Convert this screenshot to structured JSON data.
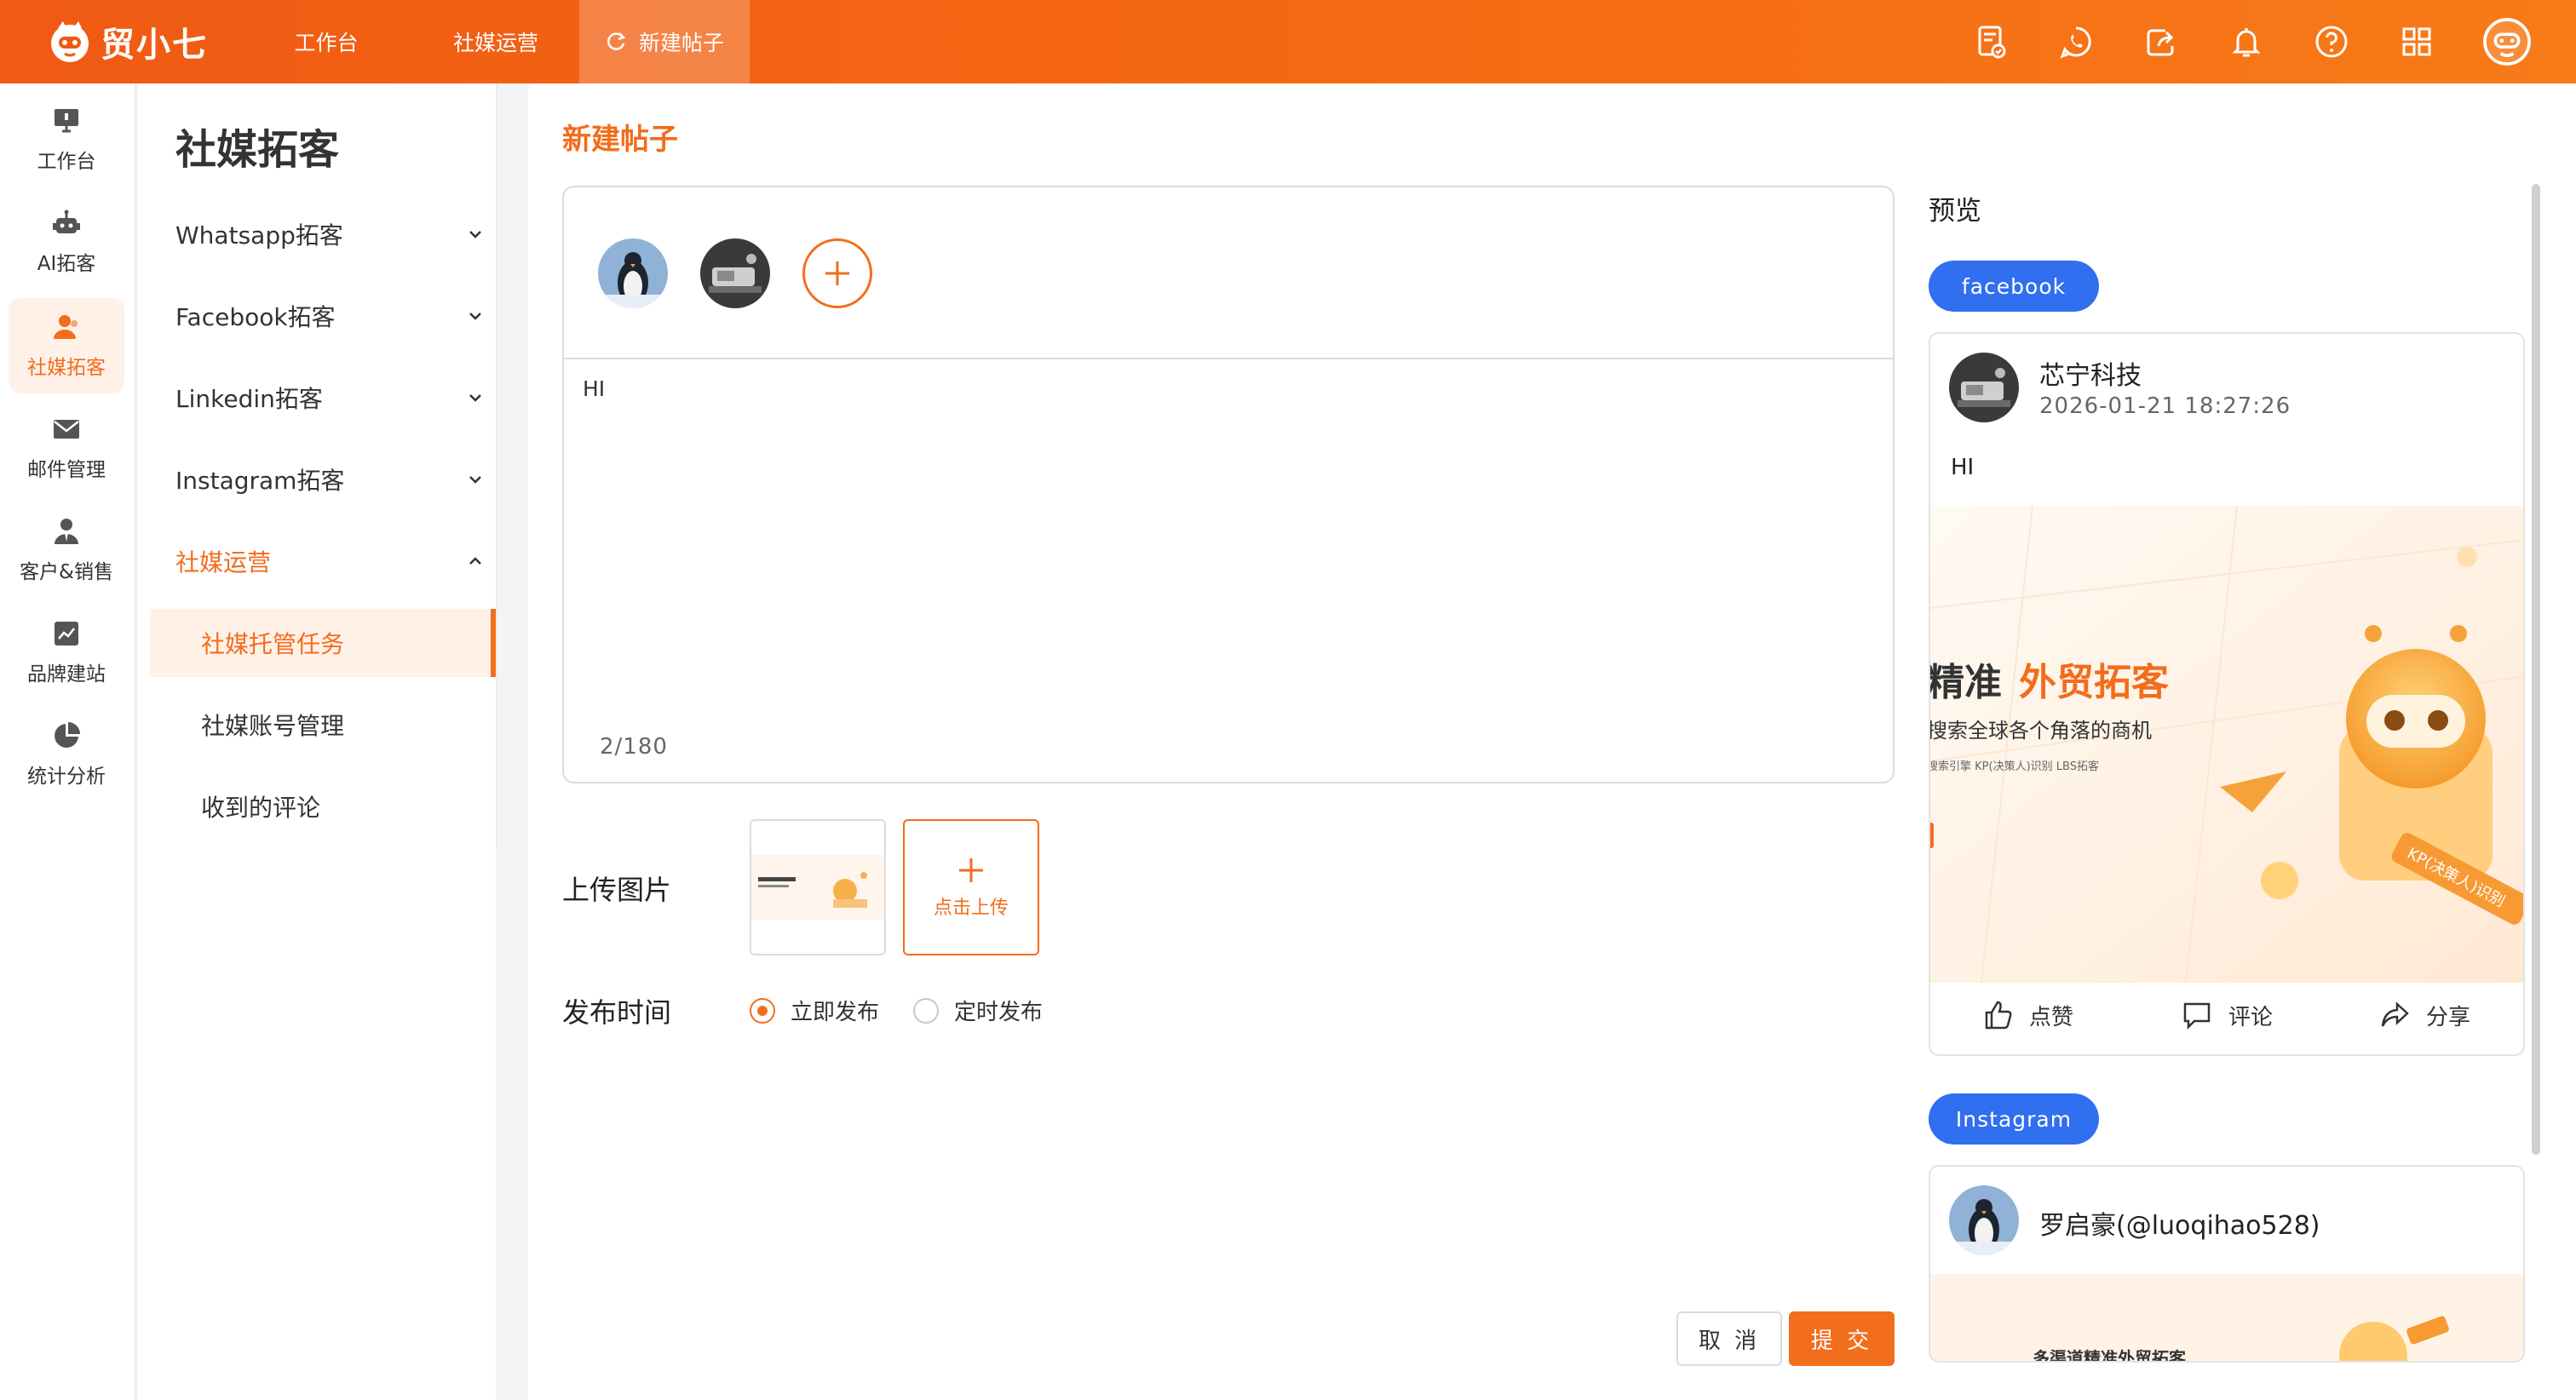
{
  "app": {
    "name": "贸小七"
  },
  "top_tabs": [
    {
      "label": "工作台"
    },
    {
      "label": "社媒运营"
    },
    {
      "label": "新建帖子",
      "active": true
    }
  ],
  "top_icons": [
    "document-check-icon",
    "whatsapp-icon",
    "share-export-icon",
    "bell-icon",
    "help-icon",
    "apps-grid-icon",
    "user-avatar-icon"
  ],
  "rail": [
    {
      "label": "工作台",
      "icon": "workbench-icon"
    },
    {
      "label": "AI拓客",
      "icon": "robot-icon"
    },
    {
      "label": "社媒拓客",
      "icon": "people-icon",
      "active": true
    },
    {
      "label": "邮件管理",
      "icon": "mail-icon"
    },
    {
      "label": "客户&销售",
      "icon": "customer-icon"
    },
    {
      "label": "品牌建站",
      "icon": "chart-site-icon"
    },
    {
      "label": "统计分析",
      "icon": "pie-chart-icon"
    }
  ],
  "menu": {
    "title": "社媒拓客",
    "items": [
      {
        "label": "Whatsapp拓客"
      },
      {
        "label": "Facebook拓客"
      },
      {
        "label": "Linkedin拓客"
      },
      {
        "label": "Instagram拓客"
      },
      {
        "label": "社媒运营",
        "open": true
      }
    ],
    "sub_items": [
      {
        "label": "社媒托管任务",
        "active": true
      },
      {
        "label": "社媒账号管理"
      },
      {
        "label": "收到的评论"
      }
    ]
  },
  "editor": {
    "page_title": "新建帖子",
    "content": "HI",
    "counter": "2/180",
    "upload_label": "上传图片",
    "upload_button": "点击上传",
    "publish_label": "发布时间",
    "publish_options": [
      {
        "label": "立即发布",
        "checked": true
      },
      {
        "label": "定时发布",
        "checked": false
      }
    ],
    "cancel": "取 消",
    "submit": "提 交"
  },
  "preview": {
    "title": "预览",
    "facebook": {
      "tag": "facebook",
      "name": "芯宁科技",
      "time": "2026-01-21 18:27:26",
      "text": "HI",
      "banner_title_a": "精准",
      "banner_title_b": "外贸拓客",
      "banner_sub": "搜索全球各个角落的商机",
      "banner_tags": "搜索引擎    KP(决策人)识别    LBS拓客",
      "banner_badge": "KP(决策人)识别",
      "actions": [
        {
          "label": "点赞"
        },
        {
          "label": "评论"
        },
        {
          "label": "分享"
        }
      ]
    },
    "instagram": {
      "tag": "Instagram",
      "name": "罗启豪(@luoqihao528)",
      "banner_title": "多渠道精准外贸拓客"
    }
  },
  "colors": {
    "brand": "#f26d1c",
    "tag_blue": "#2f6ff0"
  }
}
